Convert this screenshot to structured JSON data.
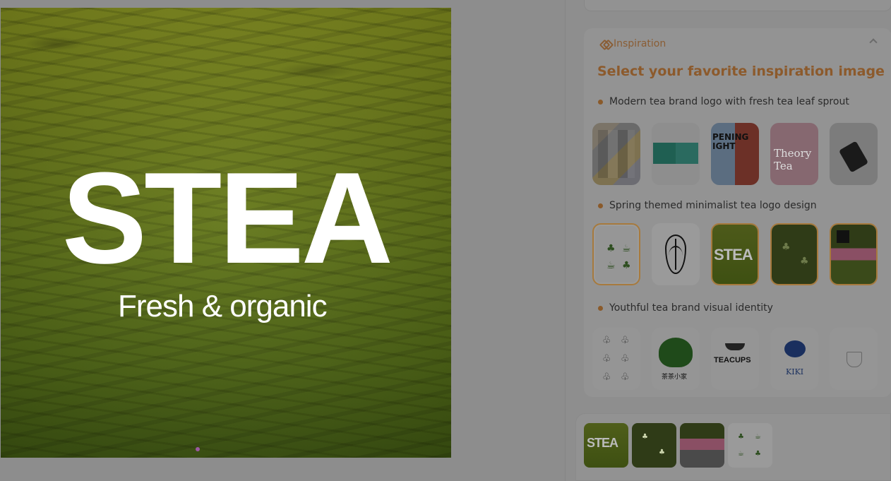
{
  "preview": {
    "brand": "STEA",
    "tagline": "Fresh & organic"
  },
  "top_field": {
    "value": ""
  },
  "inspiration": {
    "header_label": "Inspiration",
    "title": "Select your favorite inspiration image",
    "groups": [
      {
        "label": "Modern tea brand logo with fresh tea leaf sprout"
      },
      {
        "label": "Spring themed minimalist tea logo design"
      },
      {
        "label": "Youthful tea brand visual identity"
      }
    ]
  },
  "thumb_text": {
    "opening": "PENING\nIGHT",
    "theory": "Theory Tea",
    "stea": "STEA",
    "teacups": "TEACUPS",
    "kiki": "KIKI",
    "tree_label": "茶茶小家"
  },
  "colors": {
    "accent": "#8c5a2c",
    "overlay": "#8b8b8b"
  }
}
